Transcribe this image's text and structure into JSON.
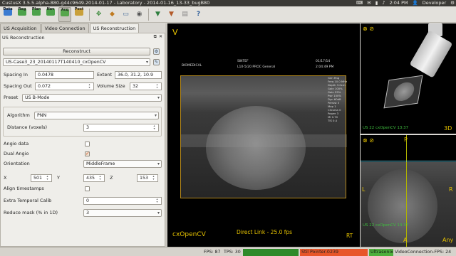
{
  "window": {
    "title": "CustusX 3.5.5.alpha-880-g44c9649.2014-01-17 - Laboratory - 2014-01-16_13-33_bugB80"
  },
  "system_tray": {
    "icons": [
      "keyboard-icon",
      "mail-icon",
      "battery-icon",
      "volume-icon"
    ],
    "time": "2:04 PM",
    "user": "Developer"
  },
  "toolbar": {
    "workflow": [
      {
        "label": "Data",
        "icon": "data-icon",
        "color": "#3b7bd1",
        "active": false
      },
      {
        "label": "Reg",
        "icon": "registration-icon",
        "color": "#4da24b",
        "active": false
      },
      {
        "label": "Plan",
        "icon": "plan-icon",
        "color": "#4da24b",
        "active": false
      },
      {
        "label": "Nav",
        "icon": "navigation-icon",
        "color": "#4da24b",
        "active": false
      },
      {
        "label": "Acq",
        "icon": "acquisition-icon",
        "color": "#56a64c",
        "active": true
      },
      {
        "label": "Post",
        "icon": "postprocess-icon",
        "color": "#c9a03a",
        "active": false
      }
    ],
    "tools": [
      "center-image-icon",
      "center-tool-icon",
      "measure-icon",
      "camera-icon",
      "annotation-icon",
      "tool-icon",
      "frame-icon",
      "help-icon"
    ]
  },
  "tabs": [
    {
      "label": "US Acquisition",
      "active": false
    },
    {
      "label": "Video Connection",
      "active": false
    },
    {
      "label": "US Reconstruction",
      "active": true
    }
  ],
  "panel": {
    "title": "US Reconstruction",
    "reconstruct_label": "Reconstruct",
    "input_file": "US-Case3_23_20140117T140410_cxOpenCV",
    "spacing_in_label": "Spacing In",
    "spacing_in_value": "0.0478",
    "extent_label": "Extent",
    "extent_value": "36.0, 31.2, 10.9",
    "spacing_out_label": "Spacing Out",
    "spacing_out_value": "0.072",
    "volume_size_label": "Volume Size",
    "volume_size_value": "32",
    "preset_label": "Preset",
    "preset_value": "US B-Mode",
    "algorithm_label": "Algorithm",
    "algorithm_value": "PNN",
    "distance_label": "Distance (voxels)",
    "distance_value": "3",
    "angio_label": "Angio data",
    "angio_checked": false,
    "dual_angio_label": "Dual Angio",
    "dual_angio_checked": true,
    "orientation_label": "Orientation",
    "orientation_value": "MiddleFrame",
    "x_label": "X",
    "x_value": "501",
    "y_label": "Y",
    "y_value": "435",
    "z_label": "Z",
    "z_value": "153",
    "align_label": "Align timestamps",
    "align_checked": false,
    "temporal_label": "Extra Temporal Calib",
    "temporal_value": "0",
    "reduce_label": "Reduce mask (% in 1D)",
    "reduce_value": "3"
  },
  "views": {
    "main": {
      "corner_label": "V",
      "name_label": "cxOpenCV",
      "status_label": "Direct Link - 25.0 fps",
      "rt_label": "RT",
      "us_header_left": "BIOMEDICAL",
      "us_header_mid1": "SINTEF",
      "us_header_mid2": "L10-5/20 PROC General",
      "us_header_right1": "01/17/14",
      "us_header_right2": "2:04:49 PM",
      "us_params": [
        "Gen Rng",
        "Freq 10.0 MHz",
        "Depth 3.0cm",
        "Gain 100%",
        "Gain 55%",
        "Pwr 100%",
        "Dyn 60dB",
        "Persist 3",
        "Map 1",
        "Chroma 0",
        "Power 3",
        "MI 0.70",
        "TIS 0.4"
      ]
    },
    "view3d": {
      "corner_label": "3D",
      "info_label": "US 22 cxOpenCV 13:37"
    },
    "view2d": {
      "top_label": "P",
      "left_label": "L",
      "right_label": "R",
      "bottom_label": "A",
      "corner_label": "Any",
      "info_label": "US 22 cxOpenCV 13:37"
    }
  },
  "status": {
    "fps": "FPS: 87",
    "tps": "TPS: 30",
    "tool1": "Stil Pointer-0239",
    "tool1_color": "#e8562a",
    "tool2": "Ultrasonix L14-5",
    "tool2_color": "#4fb03d",
    "tool0_color": "#2f8a2a",
    "video": "VideoConnection-FPS: 24"
  }
}
